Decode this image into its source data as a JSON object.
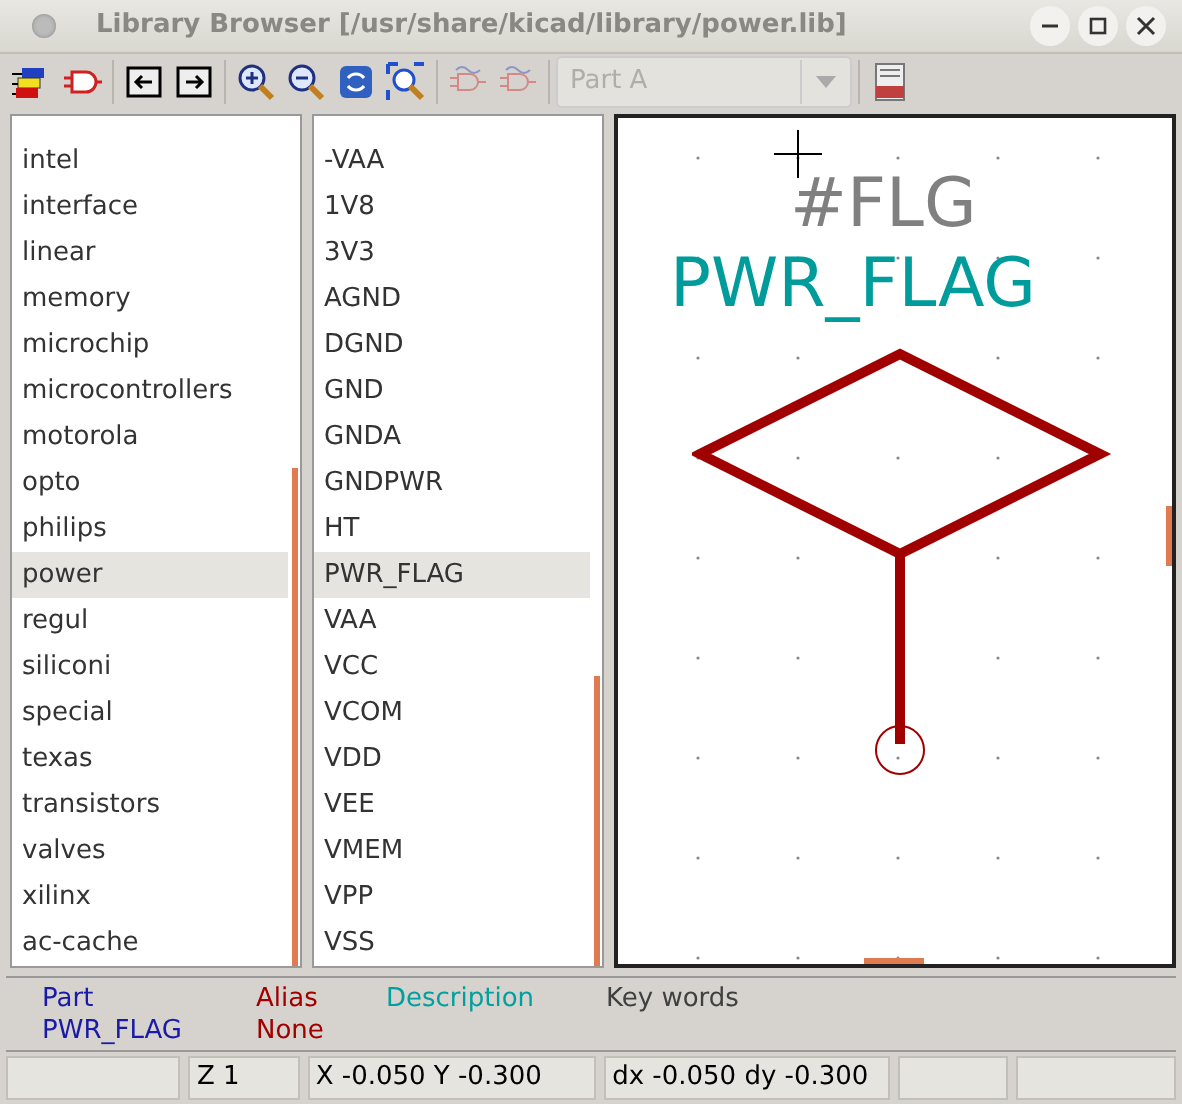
{
  "window": {
    "title": "Library Browser [/usr/share/kicad/library/power.lib]"
  },
  "toolbar": {
    "buttons": [
      {
        "kind": "libraries",
        "disabled": false
      },
      {
        "kind": "component",
        "disabled": false
      },
      {
        "kind": "previous",
        "disabled": false
      },
      {
        "kind": "next",
        "disabled": false
      },
      {
        "kind": "zoom-in",
        "disabled": false
      },
      {
        "kind": "zoom-out",
        "disabled": false
      },
      {
        "kind": "refresh",
        "disabled": false
      },
      {
        "kind": "zoom-fit",
        "disabled": false
      },
      {
        "kind": "gate-normal",
        "disabled": true
      },
      {
        "kind": "gate-convert",
        "disabled": true
      }
    ],
    "part_select": {
      "value": "Part A",
      "disabled": true
    },
    "pdf_button": {
      "kind": "pdf",
      "disabled": false
    }
  },
  "libraries": [
    {
      "name": "intel",
      "selected": false
    },
    {
      "name": "interface",
      "selected": false
    },
    {
      "name": "linear",
      "selected": false
    },
    {
      "name": "memory",
      "selected": false
    },
    {
      "name": "microchip",
      "selected": false
    },
    {
      "name": "microcontrollers",
      "selected": false
    },
    {
      "name": "motorola",
      "selected": false
    },
    {
      "name": "opto",
      "selected": false
    },
    {
      "name": "philips",
      "selected": false
    },
    {
      "name": "power",
      "selected": true
    },
    {
      "name": "regul",
      "selected": false
    },
    {
      "name": "siliconi",
      "selected": false
    },
    {
      "name": "special",
      "selected": false
    },
    {
      "name": "texas",
      "selected": false
    },
    {
      "name": "transistors",
      "selected": false
    },
    {
      "name": "valves",
      "selected": false
    },
    {
      "name": "xilinx",
      "selected": false
    },
    {
      "name": "ac-cache",
      "selected": false
    }
  ],
  "components": [
    {
      "name": "-VAA",
      "selected": false
    },
    {
      "name": "1V8",
      "selected": false
    },
    {
      "name": "3V3",
      "selected": false
    },
    {
      "name": "AGND",
      "selected": false
    },
    {
      "name": "DGND",
      "selected": false
    },
    {
      "name": "GND",
      "selected": false
    },
    {
      "name": "GNDA",
      "selected": false
    },
    {
      "name": "GNDPWR",
      "selected": false
    },
    {
      "name": "HT",
      "selected": false
    },
    {
      "name": "PWR_FLAG",
      "selected": true
    },
    {
      "name": "VAA",
      "selected": false
    },
    {
      "name": "VCC",
      "selected": false
    },
    {
      "name": "VCOM",
      "selected": false
    },
    {
      "name": "VDD",
      "selected": false
    },
    {
      "name": "VEE",
      "selected": false
    },
    {
      "name": "VMEM",
      "selected": false
    },
    {
      "name": "VPP",
      "selected": false
    },
    {
      "name": "VSS",
      "selected": false
    }
  ],
  "canvas": {
    "reference": "#FLG",
    "value": "PWR_FLAG"
  },
  "info": {
    "headers": [
      "Part",
      "Alias",
      "Description",
      "Key words"
    ],
    "values": [
      "PWR_FLAG",
      "None"
    ]
  },
  "status_bar": [
    "Z 1",
    "X -0.050  Y -0.300",
    "dx -0.050  dy -0.300"
  ]
}
